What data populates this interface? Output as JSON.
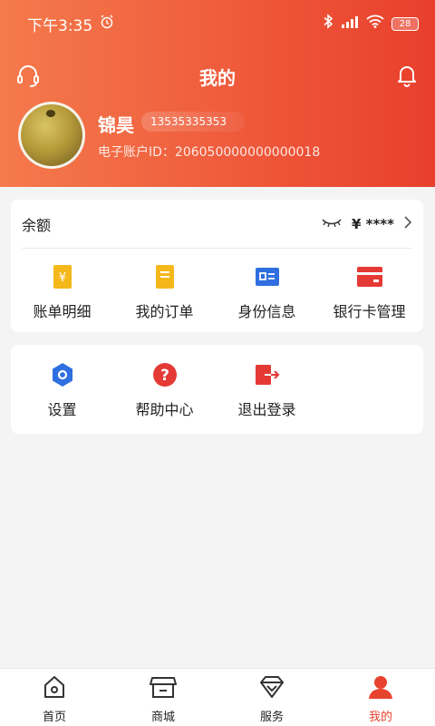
{
  "status_bar": {
    "time": "下午3:35",
    "battery": "28"
  },
  "header": {
    "title": "我的",
    "username": "锦昊",
    "phone": "13535335353",
    "account_id": "电子账户ID：206050000000000018"
  },
  "balance": {
    "label": "余额",
    "amount": "¥ ****"
  },
  "quick_actions": [
    {
      "label": "账单明细",
      "icon": "bill-icon"
    },
    {
      "label": "我的订单",
      "icon": "order-icon"
    },
    {
      "label": "身份信息",
      "icon": "id-card-icon"
    },
    {
      "label": "银行卡管理",
      "icon": "bank-card-icon"
    }
  ],
  "more_actions": [
    {
      "label": "设置",
      "icon": "settings-icon"
    },
    {
      "label": "帮助中心",
      "icon": "help-icon"
    },
    {
      "label": "退出登录",
      "icon": "logout-icon"
    }
  ],
  "tabs": [
    {
      "label": "首页",
      "icon": "home-icon"
    },
    {
      "label": "商城",
      "icon": "shop-icon"
    },
    {
      "label": "服务",
      "icon": "service-icon"
    },
    {
      "label": "我的",
      "icon": "profile-icon",
      "active": true
    }
  ],
  "colors": {
    "accent": "#e8432f",
    "header_start": "#f47a4c",
    "header_end": "#e83f2c",
    "yellow": "#f5b81b",
    "blue": "#2f6fe0",
    "red": "#e53935"
  }
}
